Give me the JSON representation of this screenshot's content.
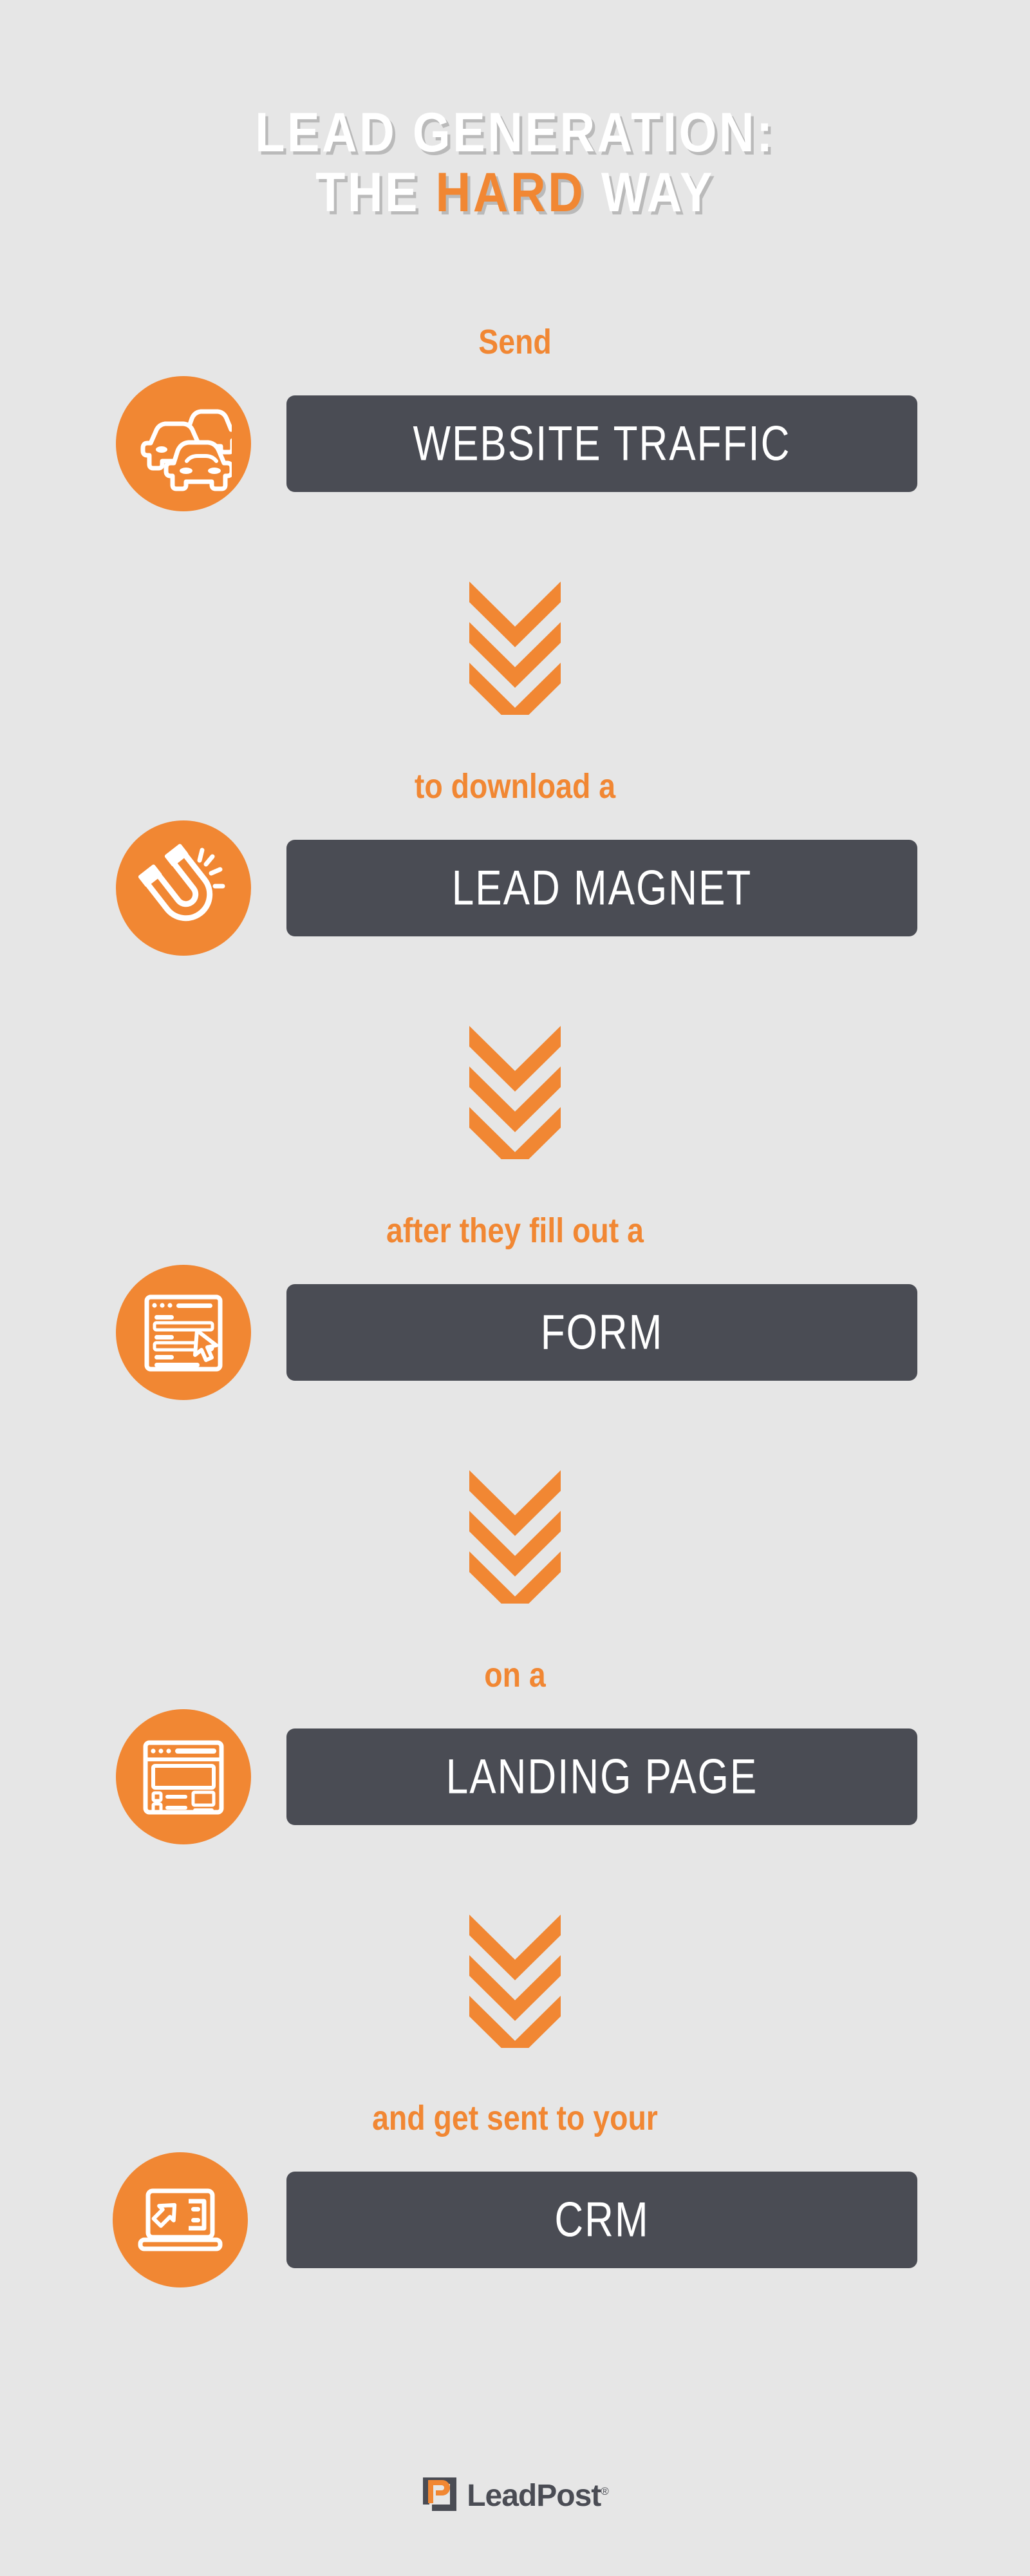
{
  "page": {
    "background_color": "#e6e6e6",
    "accent_color": "#f18733",
    "bar_color": "#4a4c54",
    "text_color": "#ffffff"
  },
  "title": {
    "line1": "LEAD GENERATION:",
    "line2_before": "THE ",
    "line2_highlight": "HARD",
    "line2_after": " WAY"
  },
  "steps": [
    {
      "label": "Send",
      "bar_text": "WEBSITE TRAFFIC",
      "icon": "traffic-cars-icon"
    },
    {
      "label": "to download a",
      "bar_text": "LEAD MAGNET",
      "icon": "magnet-icon"
    },
    {
      "label": "after they fill out a",
      "bar_text": "FORM",
      "icon": "form-cursor-icon"
    },
    {
      "label": "on a",
      "bar_text": "LANDING PAGE",
      "icon": "landing-page-icon"
    },
    {
      "label": "and get sent to your",
      "bar_text": "CRM",
      "icon": "laptop-crm-icon"
    }
  ],
  "arrows": {
    "icon": "triple-chevron-down-icon",
    "count": 4
  },
  "logo": {
    "name": "LeadPost",
    "registered_mark": "®",
    "mark_icon": "leadpost-logo-mark"
  }
}
